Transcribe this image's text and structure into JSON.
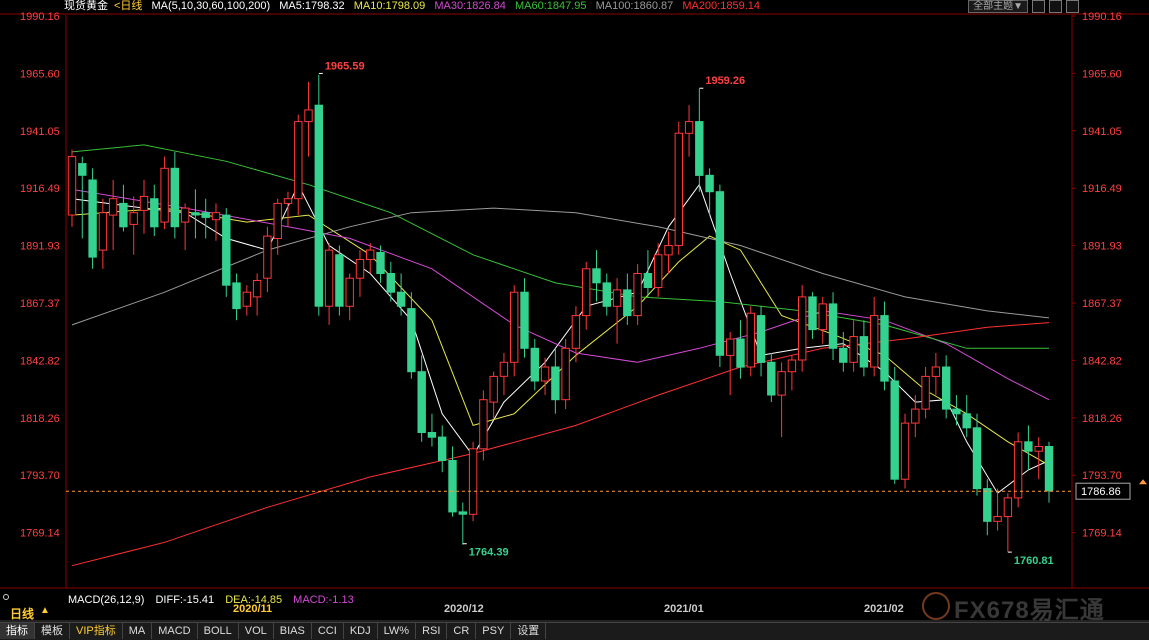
{
  "legend": {
    "instrument": "现货黄金",
    "period": "<日线",
    "ma_params": "MA(5,10,30,60,100,200)",
    "ma5": "MA5:1798.32",
    "ma10": "MA10:1798.09",
    "ma30": "MA30:1826.84",
    "ma60": "MA60:1847.95",
    "ma100": "MA100:1860.87",
    "ma200": "MA200:1859.14"
  },
  "top_buttons": {
    "theme": "全部主题▼"
  },
  "price_axis": [
    "1990.16",
    "1965.60",
    "1941.05",
    "1916.49",
    "1891.93",
    "1867.37",
    "1842.82",
    "1818.26",
    "1793.70",
    "1769.14"
  ],
  "price_tag": "1786.86",
  "annotations": {
    "high1": "1965.59",
    "high2": "1959.26",
    "low1": "1764.39",
    "low2": "1760.81"
  },
  "macd": {
    "label": "MACD(26,12,9)",
    "diff": "DIFF:-15.41",
    "dea": "DEA:-14.85",
    "macd": "MACD:-1.13"
  },
  "period_label": "日线",
  "date_labels": [
    "2020/11",
    "2020/12",
    "2021/01",
    "2021/02"
  ],
  "tabs": [
    "指标",
    "模板",
    "VIP指标",
    "MA",
    "MACD",
    "BOLL",
    "VOL",
    "BIAS",
    "CCI",
    "KDJ",
    "LW%",
    "RSI",
    "CR",
    "PSY",
    "设置"
  ],
  "watermark": "FX678易汇通",
  "colors": {
    "up": "#ff3838",
    "down": "#35d28f",
    "ma5": "#ffffff",
    "ma10": "#e8e84a",
    "ma30": "#d54ad5",
    "ma60": "#38c038",
    "ma100": "#9a9a9a",
    "ma200": "#ff3030",
    "axis_text": "#ff4040",
    "grid": "#8b0000"
  },
  "chart_data": {
    "type": "candlestick",
    "ylim": [
      1755,
      1995
    ],
    "x": [
      "2020-11",
      "2020-12",
      "2021-01",
      "2021-02"
    ],
    "series": [
      {
        "open": 1905,
        "high": 1933,
        "low": 1900,
        "close": 1930
      },
      {
        "open": 1927,
        "high": 1930,
        "low": 1895,
        "close": 1922
      },
      {
        "open": 1920,
        "high": 1925,
        "low": 1882,
        "close": 1887
      },
      {
        "open": 1890,
        "high": 1912,
        "low": 1882,
        "close": 1906
      },
      {
        "open": 1905,
        "high": 1920,
        "low": 1890,
        "close": 1912
      },
      {
        "open": 1910,
        "high": 1918,
        "low": 1898,
        "close": 1900
      },
      {
        "open": 1901,
        "high": 1913,
        "low": 1888,
        "close": 1906
      },
      {
        "open": 1907,
        "high": 1920,
        "low": 1897,
        "close": 1913
      },
      {
        "open": 1912,
        "high": 1918,
        "low": 1896,
        "close": 1900
      },
      {
        "open": 1902,
        "high": 1930,
        "low": 1899,
        "close": 1925
      },
      {
        "open": 1925,
        "high": 1932,
        "low": 1895,
        "close": 1900
      },
      {
        "open": 1902,
        "high": 1910,
        "low": 1890,
        "close": 1908
      },
      {
        "open": 1906,
        "high": 1916,
        "low": 1895,
        "close": 1905
      },
      {
        "open": 1906,
        "high": 1912,
        "low": 1895,
        "close": 1904
      },
      {
        "open": 1903,
        "high": 1910,
        "low": 1894,
        "close": 1906
      },
      {
        "open": 1905,
        "high": 1908,
        "low": 1870,
        "close": 1875
      },
      {
        "open": 1876,
        "high": 1880,
        "low": 1860,
        "close": 1865
      },
      {
        "open": 1866,
        "high": 1875,
        "low": 1862,
        "close": 1872
      },
      {
        "open": 1870,
        "high": 1880,
        "low": 1862,
        "close": 1877
      },
      {
        "open": 1878,
        "high": 1900,
        "low": 1872,
        "close": 1896
      },
      {
        "open": 1895,
        "high": 1912,
        "low": 1888,
        "close": 1910
      },
      {
        "open": 1910,
        "high": 1915,
        "low": 1900,
        "close": 1912
      },
      {
        "open": 1912,
        "high": 1948,
        "low": 1905,
        "close": 1945
      },
      {
        "open": 1945,
        "high": 1962,
        "low": 1930,
        "close": 1950
      },
      {
        "open": 1952,
        "high": 1965,
        "low": 1862,
        "close": 1866
      },
      {
        "open": 1866,
        "high": 1893,
        "low": 1858,
        "close": 1890
      },
      {
        "open": 1888,
        "high": 1892,
        "low": 1862,
        "close": 1866
      },
      {
        "open": 1866,
        "high": 1880,
        "low": 1860,
        "close": 1878
      },
      {
        "open": 1878,
        "high": 1890,
        "low": 1870,
        "close": 1886
      },
      {
        "open": 1886,
        "high": 1893,
        "low": 1880,
        "close": 1890
      },
      {
        "open": 1889,
        "high": 1892,
        "low": 1876,
        "close": 1880
      },
      {
        "open": 1880,
        "high": 1885,
        "low": 1868,
        "close": 1872
      },
      {
        "open": 1872,
        "high": 1880,
        "low": 1862,
        "close": 1866
      },
      {
        "open": 1865,
        "high": 1872,
        "low": 1835,
        "close": 1838
      },
      {
        "open": 1838,
        "high": 1845,
        "low": 1808,
        "close": 1812
      },
      {
        "open": 1812,
        "high": 1820,
        "low": 1806,
        "close": 1810
      },
      {
        "open": 1810,
        "high": 1815,
        "low": 1795,
        "close": 1800
      },
      {
        "open": 1800,
        "high": 1806,
        "low": 1776,
        "close": 1778
      },
      {
        "open": 1778,
        "high": 1782,
        "low": 1764,
        "close": 1777
      },
      {
        "open": 1777,
        "high": 1808,
        "low": 1774,
        "close": 1805
      },
      {
        "open": 1805,
        "high": 1830,
        "low": 1800,
        "close": 1826
      },
      {
        "open": 1825,
        "high": 1838,
        "low": 1818,
        "close": 1836
      },
      {
        "open": 1836,
        "high": 1846,
        "low": 1828,
        "close": 1842
      },
      {
        "open": 1842,
        "high": 1875,
        "low": 1836,
        "close": 1872
      },
      {
        "open": 1872,
        "high": 1878,
        "low": 1844,
        "close": 1848
      },
      {
        "open": 1848,
        "high": 1852,
        "low": 1830,
        "close": 1834
      },
      {
        "open": 1834,
        "high": 1844,
        "low": 1828,
        "close": 1840
      },
      {
        "open": 1840,
        "high": 1848,
        "low": 1820,
        "close": 1826
      },
      {
        "open": 1826,
        "high": 1852,
        "low": 1822,
        "close": 1848
      },
      {
        "open": 1848,
        "high": 1866,
        "low": 1842,
        "close": 1862
      },
      {
        "open": 1862,
        "high": 1885,
        "low": 1856,
        "close": 1882
      },
      {
        "open": 1882,
        "high": 1890,
        "low": 1868,
        "close": 1876
      },
      {
        "open": 1876,
        "high": 1880,
        "low": 1862,
        "close": 1866
      },
      {
        "open": 1866,
        "high": 1878,
        "low": 1850,
        "close": 1873
      },
      {
        "open": 1873,
        "high": 1880,
        "low": 1858,
        "close": 1862
      },
      {
        "open": 1862,
        "high": 1884,
        "low": 1858,
        "close": 1880
      },
      {
        "open": 1880,
        "high": 1890,
        "low": 1870,
        "close": 1874
      },
      {
        "open": 1874,
        "high": 1893,
        "low": 1870,
        "close": 1888
      },
      {
        "open": 1888,
        "high": 1898,
        "low": 1880,
        "close": 1892
      },
      {
        "open": 1892,
        "high": 1945,
        "low": 1888,
        "close": 1940
      },
      {
        "open": 1940,
        "high": 1952,
        "low": 1930,
        "close": 1945
      },
      {
        "open": 1945,
        "high": 1959,
        "low": 1915,
        "close": 1922
      },
      {
        "open": 1922,
        "high": 1925,
        "low": 1905,
        "close": 1915
      },
      {
        "open": 1915,
        "high": 1918,
        "low": 1840,
        "close": 1845
      },
      {
        "open": 1845,
        "high": 1855,
        "low": 1828,
        "close": 1852
      },
      {
        "open": 1852,
        "high": 1860,
        "low": 1835,
        "close": 1840
      },
      {
        "open": 1840,
        "high": 1866,
        "low": 1836,
        "close": 1863
      },
      {
        "open": 1862,
        "high": 1866,
        "low": 1836,
        "close": 1842
      },
      {
        "open": 1842,
        "high": 1846,
        "low": 1825,
        "close": 1828
      },
      {
        "open": 1828,
        "high": 1842,
        "low": 1810,
        "close": 1838
      },
      {
        "open": 1838,
        "high": 1845,
        "low": 1830,
        "close": 1843
      },
      {
        "open": 1843,
        "high": 1875,
        "low": 1838,
        "close": 1870
      },
      {
        "open": 1870,
        "high": 1872,
        "low": 1852,
        "close": 1856
      },
      {
        "open": 1856,
        "high": 1870,
        "low": 1850,
        "close": 1867
      },
      {
        "open": 1867,
        "high": 1872,
        "low": 1843,
        "close": 1848
      },
      {
        "open": 1848,
        "high": 1855,
        "low": 1838,
        "close": 1842
      },
      {
        "open": 1842,
        "high": 1860,
        "low": 1838,
        "close": 1853
      },
      {
        "open": 1853,
        "high": 1860,
        "low": 1836,
        "close": 1840
      },
      {
        "open": 1840,
        "high": 1870,
        "low": 1836,
        "close": 1862
      },
      {
        "open": 1862,
        "high": 1868,
        "low": 1830,
        "close": 1834
      },
      {
        "open": 1834,
        "high": 1840,
        "low": 1790,
        "close": 1792
      },
      {
        "open": 1792,
        "high": 1820,
        "low": 1788,
        "close": 1816
      },
      {
        "open": 1816,
        "high": 1828,
        "low": 1810,
        "close": 1822
      },
      {
        "open": 1822,
        "high": 1840,
        "low": 1818,
        "close": 1836
      },
      {
        "open": 1836,
        "high": 1846,
        "low": 1828,
        "close": 1840
      },
      {
        "open": 1840,
        "high": 1845,
        "low": 1818,
        "close": 1822
      },
      {
        "open": 1822,
        "high": 1828,
        "low": 1815,
        "close": 1820
      },
      {
        "open": 1820,
        "high": 1828,
        "low": 1810,
        "close": 1814
      },
      {
        "open": 1814,
        "high": 1820,
        "low": 1785,
        "close": 1788
      },
      {
        "open": 1788,
        "high": 1792,
        "low": 1768,
        "close": 1774
      },
      {
        "open": 1774,
        "high": 1788,
        "low": 1770,
        "close": 1776
      },
      {
        "open": 1776,
        "high": 1786,
        "low": 1761,
        "close": 1784
      },
      {
        "open": 1784,
        "high": 1812,
        "low": 1780,
        "close": 1808
      },
      {
        "open": 1808,
        "high": 1815,
        "low": 1796,
        "close": 1804
      },
      {
        "open": 1804,
        "high": 1810,
        "low": 1792,
        "close": 1806
      },
      {
        "open": 1806,
        "high": 1808,
        "low": 1782,
        "close": 1787
      }
    ],
    "ma_lines": {
      "ma5": [
        [
          1,
          1912
        ],
        [
          8,
          1908
        ],
        [
          12,
          1906
        ],
        [
          16,
          1895
        ],
        [
          20,
          1890
        ],
        [
          23,
          1918
        ],
        [
          26,
          1892
        ],
        [
          30,
          1880
        ],
        [
          34,
          1860
        ],
        [
          37,
          1820
        ],
        [
          40,
          1802
        ],
        [
          43,
          1825
        ],
        [
          47,
          1842
        ],
        [
          51,
          1866
        ],
        [
          56,
          1872
        ],
        [
          59,
          1900
        ],
        [
          62,
          1918
        ],
        [
          65,
          1880
        ],
        [
          68,
          1845
        ],
        [
          72,
          1848
        ],
        [
          76,
          1850
        ],
        [
          80,
          1838
        ],
        [
          83,
          1825
        ],
        [
          86,
          1826
        ],
        [
          88,
          1808
        ],
        [
          91,
          1786
        ],
        [
          94,
          1796
        ],
        [
          96,
          1800
        ]
      ],
      "ma10": [
        [
          1,
          1905
        ],
        [
          10,
          1908
        ],
        [
          18,
          1902
        ],
        [
          24,
          1905
        ],
        [
          30,
          1888
        ],
        [
          36,
          1860
        ],
        [
          40,
          1815
        ],
        [
          44,
          1820
        ],
        [
          50,
          1845
        ],
        [
          56,
          1866
        ],
        [
          60,
          1885
        ],
        [
          63,
          1896
        ],
        [
          66,
          1890
        ],
        [
          70,
          1862
        ],
        [
          75,
          1854
        ],
        [
          80,
          1845
        ],
        [
          84,
          1830
        ],
        [
          88,
          1820
        ],
        [
          92,
          1808
        ],
        [
          96,
          1798
        ]
      ],
      "ma30": [
        [
          1,
          1916
        ],
        [
          12,
          1908
        ],
        [
          22,
          1900
        ],
        [
          28,
          1895
        ],
        [
          36,
          1882
        ],
        [
          44,
          1858
        ],
        [
          50,
          1846
        ],
        [
          56,
          1842
        ],
        [
          62,
          1848
        ],
        [
          68,
          1855
        ],
        [
          74,
          1864
        ],
        [
          80,
          1860
        ],
        [
          86,
          1850
        ],
        [
          92,
          1835
        ],
        [
          96,
          1826
        ]
      ],
      "ma60": [
        [
          1,
          1932
        ],
        [
          8,
          1935
        ],
        [
          16,
          1928
        ],
        [
          24,
          1918
        ],
        [
          32,
          1906
        ],
        [
          40,
          1888
        ],
        [
          48,
          1876
        ],
        [
          56,
          1870
        ],
        [
          64,
          1868
        ],
        [
          72,
          1864
        ],
        [
          80,
          1858
        ],
        [
          88,
          1848
        ],
        [
          96,
          1848
        ]
      ],
      "ma100": [
        [
          1,
          1858
        ],
        [
          10,
          1872
        ],
        [
          20,
          1890
        ],
        [
          28,
          1900
        ],
        [
          34,
          1906
        ],
        [
          42,
          1908
        ],
        [
          50,
          1906
        ],
        [
          58,
          1900
        ],
        [
          66,
          1892
        ],
        [
          74,
          1880
        ],
        [
          82,
          1870
        ],
        [
          90,
          1864
        ],
        [
          96,
          1861
        ]
      ],
      "ma200": [
        [
          1,
          1755
        ],
        [
          10,
          1765
        ],
        [
          20,
          1780
        ],
        [
          30,
          1793
        ],
        [
          40,
          1803
        ],
        [
          50,
          1815
        ],
        [
          58,
          1828
        ],
        [
          66,
          1840
        ],
        [
          74,
          1848
        ],
        [
          82,
          1852
        ],
        [
          90,
          1857
        ],
        [
          96,
          1859
        ]
      ]
    }
  }
}
